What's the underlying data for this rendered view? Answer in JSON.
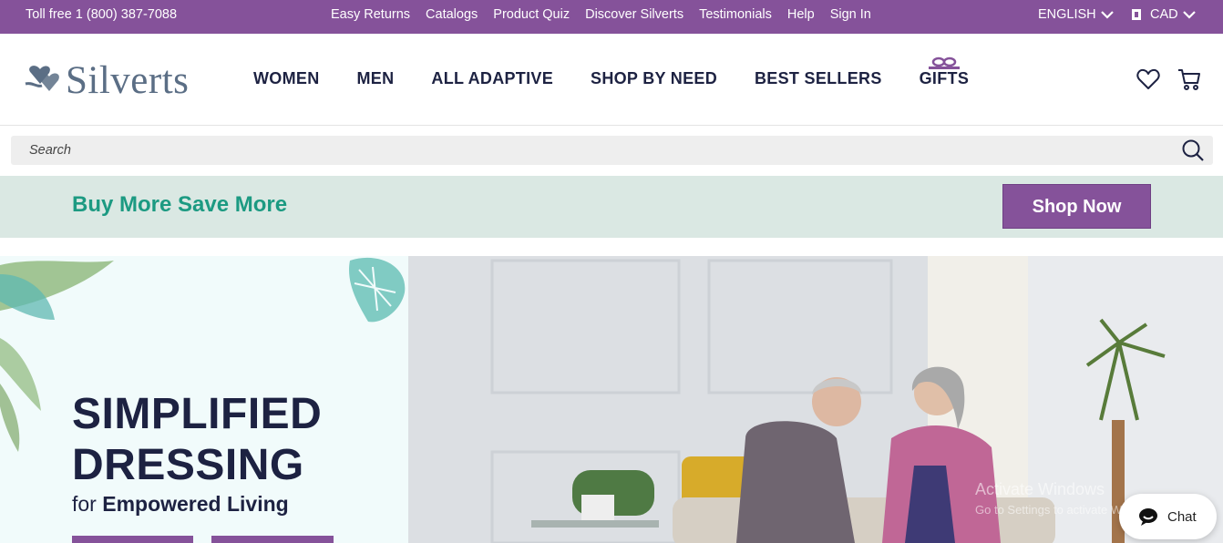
{
  "topbar": {
    "toll_free": "Toll free 1 (800) 387-7088",
    "links": [
      "Easy Returns",
      "Catalogs",
      "Product Quiz",
      "Discover Silverts",
      "Testimonials",
      "Help",
      "Sign In"
    ],
    "language": "ENGLISH",
    "currency": "CAD",
    "bg_color": "#85529a"
  },
  "header": {
    "logo_text": "Silverts",
    "nav": [
      "WOMEN",
      "MEN",
      "ALL ADAPTIVE",
      "SHOP BY NEED",
      "BEST SELLERS",
      "GIFTS"
    ],
    "icons": [
      "heart-icon",
      "cart-icon"
    ]
  },
  "search": {
    "placeholder": "Search"
  },
  "promo": {
    "message": "Buy More Save More",
    "button": "Shop Now",
    "message_color": "#1c9a82",
    "button_color": "#85529a"
  },
  "hero": {
    "headline_line1": "SIMPLIFIED",
    "headline_line2": "DRESSING",
    "sub_prefix": "for ",
    "sub_bold": "Empowered Living"
  },
  "overlay": {
    "watermark_title": "Activate Windows",
    "watermark_sub": "Go to Settings to activate Windows.",
    "chat_label": "Chat"
  }
}
